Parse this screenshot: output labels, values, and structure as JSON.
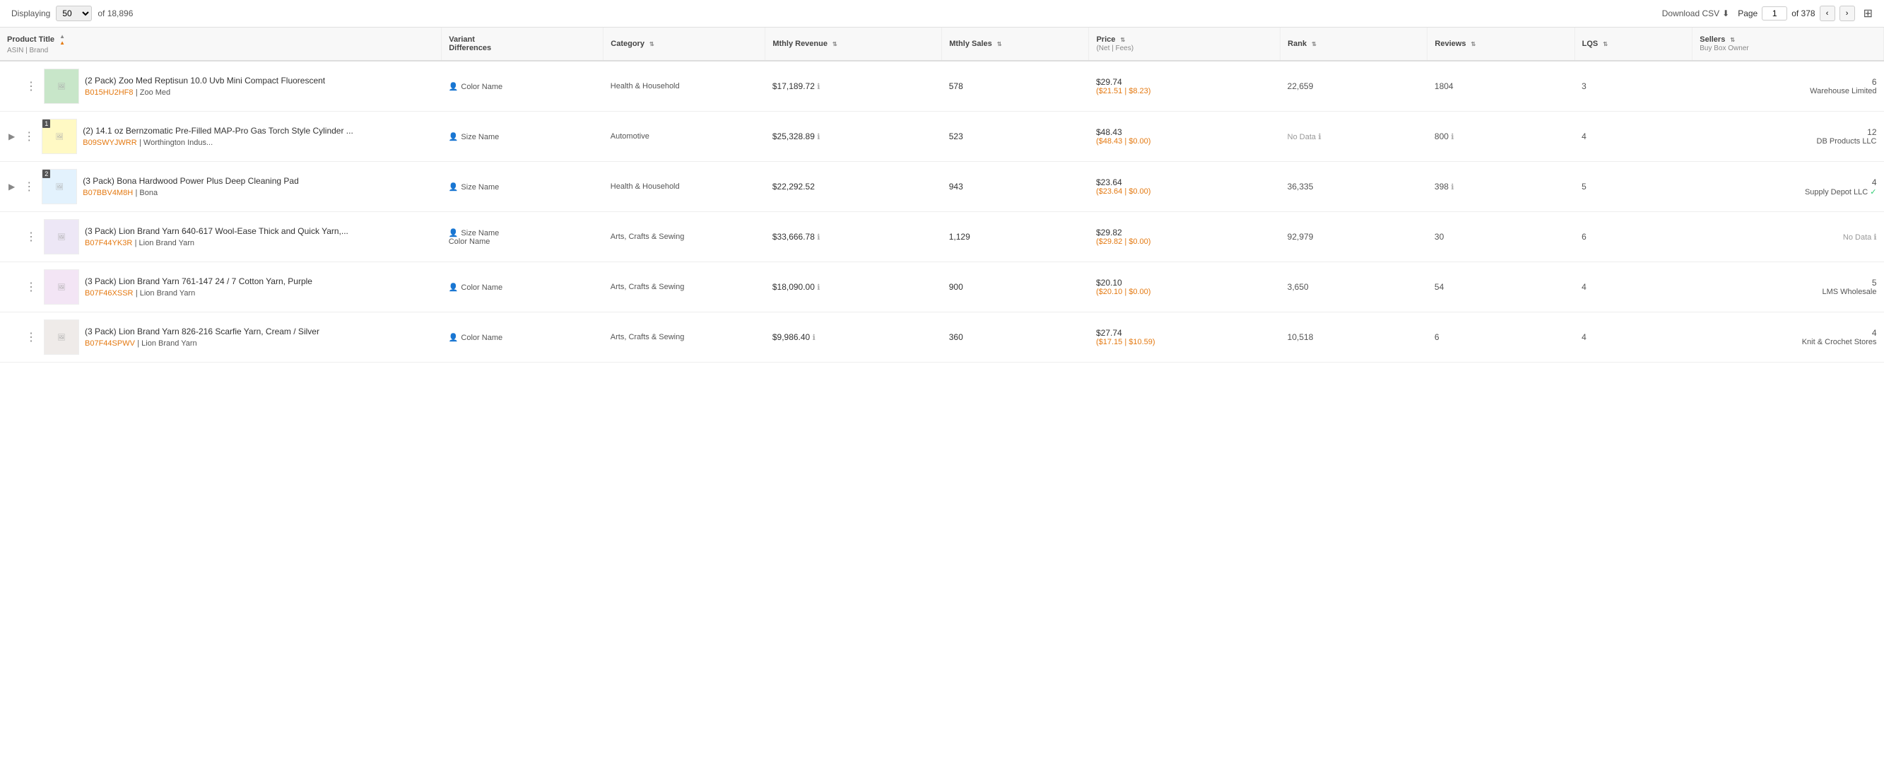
{
  "topBar": {
    "displaying_label": "Displaying",
    "per_page_value": "50",
    "total_label": "of 18,896",
    "download_label": "Download CSV",
    "page_label": "Page",
    "current_page": "1",
    "total_pages": "of 378"
  },
  "table": {
    "columns": [
      {
        "id": "product",
        "label": "Product Title",
        "sub": "ASIN | Brand",
        "sortable": true
      },
      {
        "id": "variant",
        "label": "Variant Differences",
        "sortable": false
      },
      {
        "id": "category",
        "label": "Category",
        "sortable": true
      },
      {
        "id": "revenue",
        "label": "Mthly Revenue",
        "sortable": true
      },
      {
        "id": "sales",
        "label": "Mthly Sales",
        "sortable": true
      },
      {
        "id": "price",
        "label": "Price",
        "sub": "(Net | Fees)",
        "sortable": true
      },
      {
        "id": "rank",
        "label": "Rank",
        "sortable": true
      },
      {
        "id": "reviews",
        "label": "Reviews",
        "sortable": true
      },
      {
        "id": "lqs",
        "label": "LQS",
        "sortable": true
      },
      {
        "id": "sellers",
        "label": "Sellers",
        "sub": "Buy Box Owner",
        "sortable": true
      }
    ],
    "rows": [
      {
        "id": 1,
        "has_expand": false,
        "badge": null,
        "img_color": "#c8e6c9",
        "img_label": "img",
        "title": "(2 Pack) Zoo Med Reptisun 10.0 Uvb Mini Compact Fluorescent",
        "asin": "B015HU2HF8",
        "brand": "Zoo Med",
        "variant": "Color Name",
        "category": "Health & Household",
        "revenue": "$17,189.72",
        "revenue_info": true,
        "sales": "578",
        "price_main": "$29.74",
        "price_net": "($21.51",
        "price_fees": "$8.23)",
        "rank": "22,659",
        "rank_no_data": false,
        "reviews": "1804",
        "reviews_info": false,
        "lqs": "3",
        "sellers_count": "6",
        "seller_name": "Warehouse Limited",
        "seller_verified": false
      },
      {
        "id": 2,
        "has_expand": true,
        "badge": "1",
        "img_color": "#fff9c4",
        "img_label": "img",
        "title": "(2) 14.1 oz Bernzomatic Pre-Filled MAP-Pro Gas Torch Style Cylinder ...",
        "asin": "B09SWYJWRR",
        "brand": "Worthington Indus...",
        "variant": "Size Name",
        "category": "Automotive",
        "revenue": "$25,328.89",
        "revenue_info": true,
        "sales": "523",
        "price_main": "$48.43",
        "price_net": "($48.43",
        "price_fees": "$0.00)",
        "rank": "No Data",
        "rank_no_data": true,
        "reviews": "800",
        "reviews_info": true,
        "lqs": "4",
        "sellers_count": "12",
        "seller_name": "DB Products LLC",
        "seller_verified": false
      },
      {
        "id": 3,
        "has_expand": true,
        "badge": "2",
        "img_color": "#e3f2fd",
        "img_label": "img",
        "title": "(3 Pack) Bona Hardwood Power Plus Deep Cleaning Pad",
        "asin": "B07BBV4M8H",
        "brand": "Bona",
        "variant": "Size Name",
        "category": "Health & Household",
        "revenue": "$22,292.52",
        "revenue_info": false,
        "sales": "943",
        "price_main": "$23.64",
        "price_net": "($23.64",
        "price_fees": "$0.00)",
        "rank": "36,335",
        "rank_no_data": false,
        "reviews": "398",
        "reviews_info": true,
        "lqs": "5",
        "sellers_count": "4",
        "seller_name": "Supply Depot LLC",
        "seller_verified": true
      },
      {
        "id": 4,
        "has_expand": false,
        "badge": null,
        "img_color": "#ede7f6",
        "img_label": "img",
        "title": "(3 Pack) Lion Brand Yarn 640-617 Wool-Ease Thick and Quick Yarn,...",
        "asin": "B07F44YK3R",
        "brand": "Lion Brand Yarn",
        "variant": "Size Name\nColor Name",
        "category": "Arts, Crafts & Sewing",
        "revenue": "$33,666.78",
        "revenue_info": true,
        "sales": "1,129",
        "price_main": "$29.82",
        "price_net": "($29.82",
        "price_fees": "$0.00)",
        "rank": "92,979",
        "rank_no_data": false,
        "reviews": "30",
        "reviews_info": false,
        "lqs": "6",
        "sellers_count": "",
        "seller_name": "No Data",
        "seller_verified": false
      },
      {
        "id": 5,
        "has_expand": false,
        "badge": null,
        "img_color": "#f3e5f5",
        "img_label": "img",
        "title": "(3 Pack) Lion Brand Yarn 761-147 24 / 7 Cotton Yarn, Purple",
        "asin": "B07F46XSSR",
        "brand": "Lion Brand Yarn",
        "variant": "Color Name",
        "category": "Arts, Crafts & Sewing",
        "revenue": "$18,090.00",
        "revenue_info": true,
        "sales": "900",
        "price_main": "$20.10",
        "price_net": "($20.10",
        "price_fees": "$0.00)",
        "rank": "3,650",
        "rank_no_data": false,
        "reviews": "54",
        "reviews_info": false,
        "lqs": "4",
        "sellers_count": "5",
        "seller_name": "LMS Wholesale",
        "seller_verified": false
      },
      {
        "id": 6,
        "has_expand": false,
        "badge": null,
        "img_color": "#efebe9",
        "img_label": "img",
        "title": "(3 Pack) Lion Brand Yarn 826-216 Scarfie Yarn, Cream / Silver",
        "asin": "B07F44SPWV",
        "brand": "Lion Brand Yarn",
        "variant": "Color Name",
        "category": "Arts, Crafts & Sewing",
        "revenue": "$9,986.40",
        "revenue_info": true,
        "sales": "360",
        "price_main": "$27.74",
        "price_net": "($17.15",
        "price_fees": "$10.59)",
        "rank": "10,518",
        "rank_no_data": false,
        "reviews": "6",
        "reviews_info": false,
        "lqs": "4",
        "sellers_count": "4",
        "seller_name": "Knit & Crochet Stores",
        "seller_verified": false
      }
    ]
  }
}
